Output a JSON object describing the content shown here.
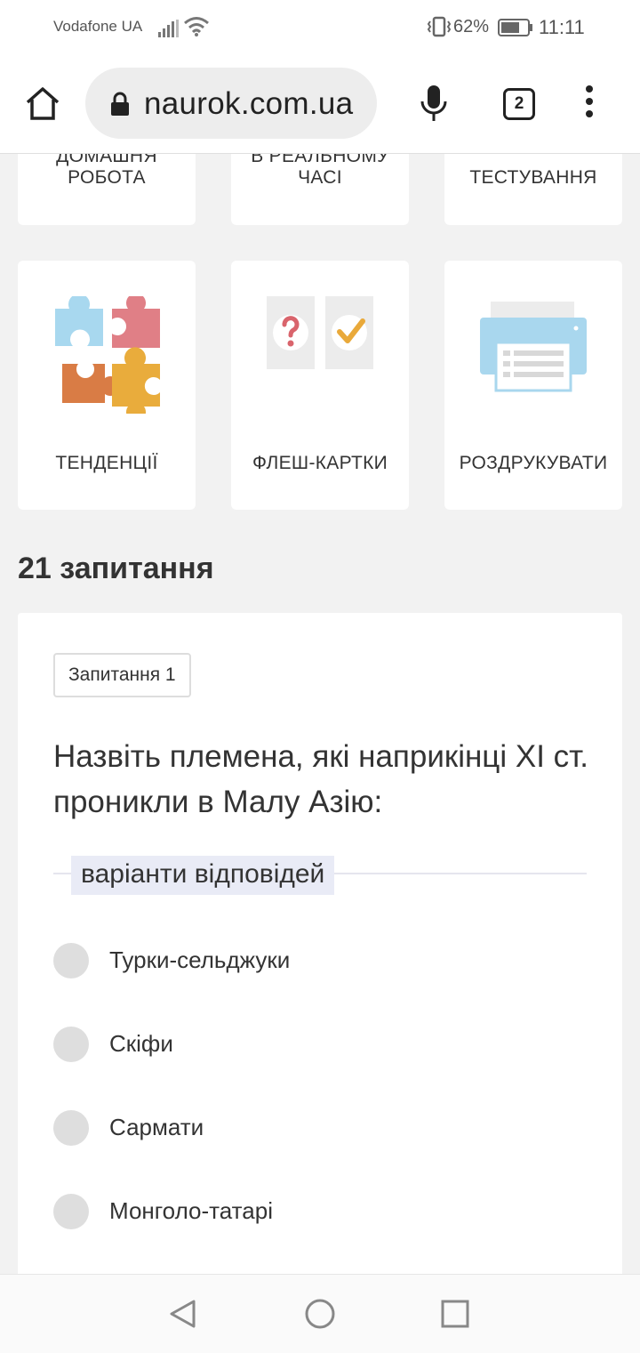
{
  "status_bar": {
    "carrier": "Vodafone UA",
    "battery": "62%",
    "time": "11:11"
  },
  "browser": {
    "url": "naurok.com.ua",
    "tab_count": "2",
    "icons": [
      "home-icon",
      "lock-icon",
      "mic-icon",
      "tabs-icon",
      "more-vert-icon"
    ]
  },
  "tiles_row1": [
    {
      "label": "ДОМАШНЯ\nРОБОТА"
    },
    {
      "label": "В РЕАЛЬНОМУ\nЧАСІ"
    },
    {
      "label": "ТЕСТУВАННЯ"
    }
  ],
  "tiles_row2": [
    {
      "label": "ТЕНДЕНЦІЇ",
      "icon": "puzzle-icon"
    },
    {
      "label": "ФЛЕШ-КАРТКИ",
      "icon": "flashcards-icon"
    },
    {
      "label": "РОЗДРУКУВАТИ",
      "icon": "printer-icon"
    }
  ],
  "section_title": "21 запитання",
  "question": {
    "badge": "Запитання 1",
    "text": "Назвіть племена, які наприкінці XI ст. проникли в Малу Азію:",
    "answers_label": "варіанти відповідей",
    "options": [
      "Турки-сельджуки",
      "Скіфи",
      "Сармати",
      "Монголо-татарі"
    ]
  },
  "colors": {
    "puzzle_blue": "#a8d8ef",
    "puzzle_red": "#e07f86",
    "puzzle_orange": "#d97c45",
    "puzzle_yellow": "#e9ac3c",
    "question_mark": "#d9646c",
    "check_mark": "#e9a93a",
    "printer_blue": "#a9d7ee"
  }
}
